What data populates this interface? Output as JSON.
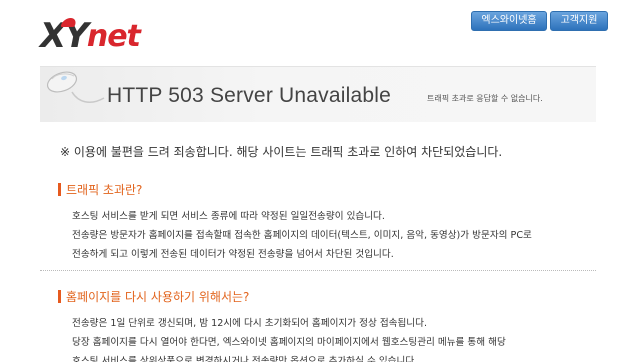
{
  "logo": {
    "text_x": "XY",
    "text_net": "net"
  },
  "top_buttons": [
    {
      "label": "엑스와이넷홈"
    },
    {
      "label": "고객지원"
    }
  ],
  "banner": {
    "title": "HTTP 503 Server Unavailable",
    "subtitle": "트래픽 초과로 응답할 수 없습니다."
  },
  "notice": "※ 이용에 불편을 드려 죄송합니다. 해당 사이트는 트래픽 초과로 인하여 차단되었습니다.",
  "section1": {
    "heading": "트래픽 초과란?",
    "lines": [
      "호스팅 서비스를 받게 되면 서비스 종류에 따라 약정된 일일전송량이 있습니다.",
      "전송량은 방문자가 홈페이지를 접속할때 접속한 홈페이지의 데이터(텍스트, 이미지, 음악, 동영상)가 방문자의 PC로",
      "전송하게 되고 이렇게 전송된 데이터가 약정된 전송량을 넘어서 차단된 것입니다."
    ]
  },
  "section2": {
    "heading": "홈페이지를 다시 사용하기 위해서는?",
    "lines": [
      "전송량은 1일 단위로 갱신되며, 밤 12시에 다시 초기화되어 홈페이지가 정상 접속됩니다.",
      "당장 홈페이지를 다시 열어야 한다면, 엑스와이넷 홈페이지의 마이페이지에서 웹호스팅관리 메뉴를 통해 해당",
      "호스팅 서비스를 상위상품으로 변경하시거나 전송량만 옵션으로 추가하실 수 있습니다."
    ]
  },
  "colors": {
    "accent": "#e2641d",
    "brand_red": "#d9262d",
    "button_blue": "#2d72bb"
  }
}
